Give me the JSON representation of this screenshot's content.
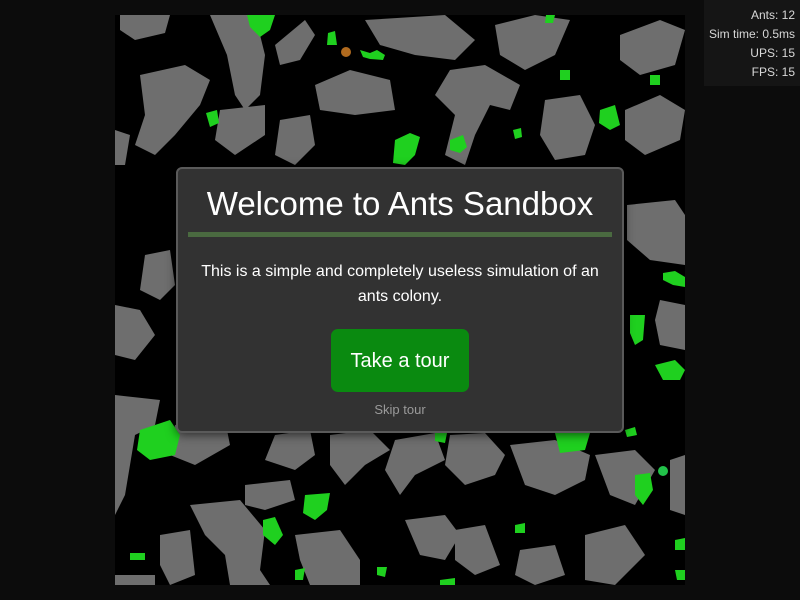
{
  "stats": {
    "ants": "Ants: 12",
    "sim_time": "Sim time: 0.5ms",
    "ups": "UPS: 15",
    "fps": "FPS: 15"
  },
  "modal": {
    "title": "Welcome to Ants Sandbox",
    "description": "This is a simple and completely useless simulation of an ants colony.",
    "tour_button_label": "Take a tour",
    "skip_label": "Skip tour"
  },
  "colors": {
    "canvas_background": "#000000",
    "terrain": "#6e6e6e",
    "food": "#1fd01f",
    "nest": "#b06a1e",
    "ant": "#22c24a",
    "tour_button": "#0a8a10",
    "modal_background": "#323232"
  }
}
